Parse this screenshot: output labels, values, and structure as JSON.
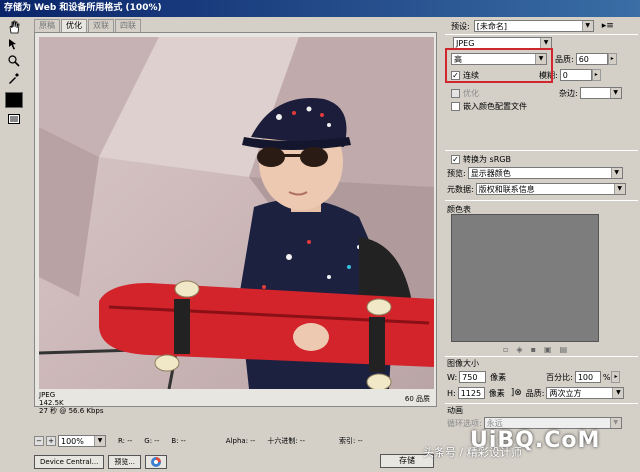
{
  "window": {
    "title": "存储为 Web 和设备所用格式 (100%)"
  },
  "tabs": [
    "原稿",
    "优化",
    "双联",
    "四联"
  ],
  "preview": {
    "format": "JPEG",
    "size": "142.5K",
    "time": "27 秒 @ 56.6 Kbps",
    "quality_label": "60 品质"
  },
  "settings": {
    "preset_label": "预设:",
    "preset_value": "[未命名]",
    "format": "JPEG",
    "quality_preset": "高",
    "quality_label": "品质:",
    "quality_value": "60",
    "progressive_label": "连续",
    "blur_label": "模糊:",
    "blur_value": "0",
    "optimized_label": "优化",
    "matte_label": "杂边:",
    "embed_profile_label": "嵌入颜色配置文件",
    "convert_srgb_label": "转换为 sRGB",
    "preview_label": "预览:",
    "preview_value": "显示器颜色",
    "metadata_label": "元数据:",
    "metadata_value": "版权和联系信息"
  },
  "color_table": {
    "title": "颜色表"
  },
  "image_size": {
    "title": "图像大小",
    "w_label": "W:",
    "w_value": "750",
    "h_label": "H:",
    "h_value": "1125",
    "unit": "像素",
    "percent_label": "百分比:",
    "percent_value": "100",
    "percent_unit": "%",
    "quality_label": "品质:",
    "quality_value": "两次立方"
  },
  "animation": {
    "title": "动画",
    "loop_label": "循环选项:",
    "loop_value": "永远"
  },
  "statusbar": {
    "zoom": "100%",
    "r": "R: --",
    "g": "G: --",
    "b": "B: --",
    "alpha": "Alpha: --",
    "hex": "十六进制: --",
    "index": "索引: --"
  },
  "buttons": {
    "device_central": "Device Central...",
    "preview": "预览...",
    "save": "存储"
  },
  "watermark": {
    "left": "头条号 / 精彩设计师",
    "brand": "UiBQ.CoM"
  },
  "colors": {
    "highlight": "#d0262e",
    "titlebar": "#0a246a"
  }
}
